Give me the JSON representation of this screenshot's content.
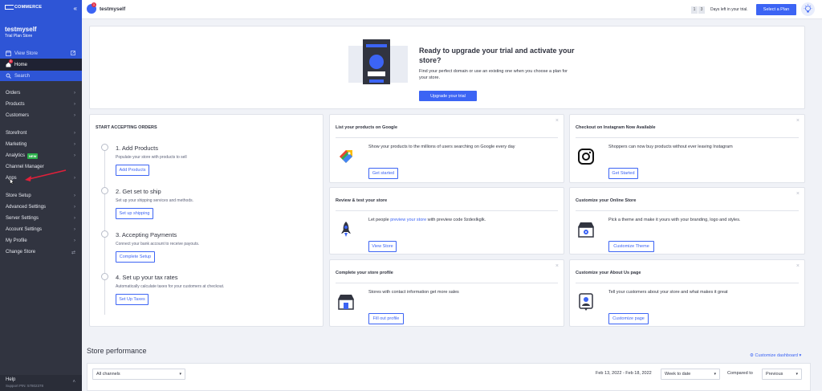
{
  "sidebar": {
    "brand": "COMMERCE",
    "store_name": "testmyself",
    "store_plan": "Trial Plan Store",
    "view_store": "View Store",
    "home": "Home",
    "home_badge": "1",
    "search": "Search",
    "items_group1": [
      "Orders",
      "Products",
      "Customers"
    ],
    "items_group2": [
      "Storefront",
      "Marketing",
      "Analytics",
      "Channel Manager",
      "Apps"
    ],
    "analytics_badge": "NEW",
    "items_group3": [
      "Store Setup",
      "Advanced Settings",
      "Server Settings",
      "Account Settings",
      "My Profile",
      "Change Store"
    ],
    "help": "Help",
    "support_pin": "Support PIN: 57802378"
  },
  "header": {
    "username": "testmyself",
    "notif_count": "1",
    "trial_digits": [
      "1",
      "3"
    ],
    "trial_text": "Days left in your trial.",
    "select_plan": "Select a Plan"
  },
  "banner": {
    "title": "Ready to upgrade your trial and activate your store?",
    "desc": "Find your perfect domain or use an existing one when you choose a plan for your store.",
    "button": "Upgrade your trial"
  },
  "orders": {
    "title": "START ACCEPTING ORDERS",
    "steps": [
      {
        "title": "1. Add Products",
        "desc": "Populate your store with products to sell",
        "button": "Add Products"
      },
      {
        "title": "2. Get set to ship",
        "desc": "Set up your shipping services and methods.",
        "button": "Set up shipping"
      },
      {
        "title": "3. Accepting Payments",
        "desc": "Connect your bank account to receive payouts.",
        "button": "Complete Setup"
      },
      {
        "title": "4. Set up your tax rates",
        "desc": "Automatically calculate taxes for your customers at checkout.",
        "button": "Set Up Taxes"
      }
    ]
  },
  "tiles": {
    "google": {
      "title": "List your products on Google",
      "text": "Show your products to the millions of users searching on Google every day",
      "button": "Get started"
    },
    "instagram": {
      "title": "Checkout on Instagram Now Available",
      "text": "Shoppers can now buy products without ever leaving Instagram",
      "button": "Get Started"
    },
    "review": {
      "title": "Review & test your store",
      "text_pre": "Let people ",
      "text_link": "preview your store",
      "text_post": " with preview code 9zdexlkglk.",
      "button": "View Store"
    },
    "customize": {
      "title": "Customize your Online Store",
      "text": "Pick a theme and make it yours with your branding, logo and styles.",
      "button": "Customize Theme"
    },
    "profile": {
      "title": "Complete your store profile",
      "text": "Stores with contact information get more sales",
      "button": "Fill out profile"
    },
    "about": {
      "title": "Customize your About Us page",
      "text": "Tell your customers about your store and what makes it great",
      "button": "Customize page"
    }
  },
  "performance": {
    "title": "Store performance",
    "customize": "Customize dashboard",
    "channel": "All channels",
    "date_range": "Feb 13, 2022 - Feb 18, 2022",
    "period": "Week to date",
    "compare_label": "Compared to",
    "compare_value": "Previous"
  },
  "colors": {
    "accent": "#3c64f4",
    "sidebar": "#313440",
    "sidebar_top": "#2e55d6",
    "annotation_arrow": "#e0203a"
  }
}
